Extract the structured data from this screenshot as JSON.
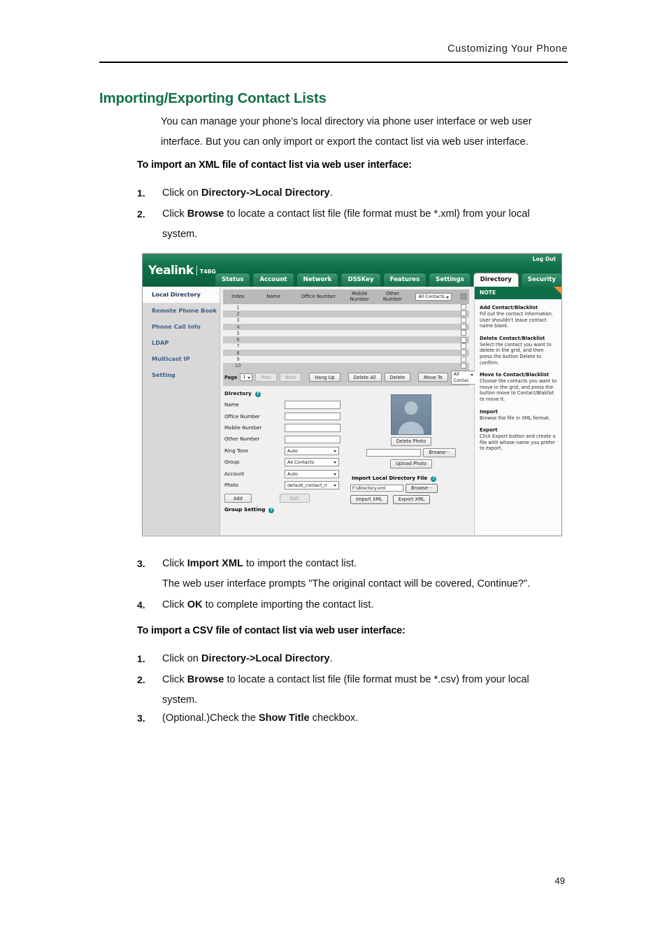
{
  "document": {
    "running_header": "Customizing Your Phone",
    "page_number": "49",
    "section_title": "Importing/Exporting Contact Lists",
    "intro": "You can manage your phone’s local directory via phone user interface or web user interface. But you can only import or export the contact list via web user interface.",
    "xml_section": {
      "heading": "To import an XML file of contact list via web user interface:",
      "steps": [
        {
          "num": "1.",
          "pre": "Click on ",
          "bold": "Directory->Local Directory",
          "post": "."
        },
        {
          "num": "2.",
          "pre": "Click ",
          "bold": "Browse",
          "post": " to locate a contact list file (file format must be *.xml) from your local system."
        },
        {
          "num": "3.",
          "pre": "Click ",
          "bold": "Import XML",
          "post": " to import the contact list."
        },
        {
          "num": "4.",
          "pre": "Click ",
          "bold": "OK",
          "post": " to complete importing the contact list."
        }
      ],
      "prompt_note": "The web user interface prompts \"The original contact will be covered, Continue?\"."
    },
    "csv_section": {
      "heading": "To import a CSV file of contact list via web user interface:",
      "steps": [
        {
          "num": "1.",
          "pre": "Click on ",
          "bold": "Directory->Local Directory",
          "post": "."
        },
        {
          "num": "2.",
          "pre": "Click ",
          "bold": "Browse",
          "post": " to locate a contact list file (file format must be *.csv) from your local system."
        },
        {
          "num": "3.",
          "pre": "(Optional.)Check the ",
          "bold": "Show Title",
          "post": " checkbox."
        }
      ]
    }
  },
  "screenshot": {
    "brand": "Yealink",
    "model": "T48G",
    "logout": "Log Out",
    "tabs": [
      {
        "label": "Status",
        "active": false
      },
      {
        "label": "Account",
        "active": false
      },
      {
        "label": "Network",
        "active": false
      },
      {
        "label": "DSSKey",
        "active": false
      },
      {
        "label": "Features",
        "active": false
      },
      {
        "label": "Settings",
        "active": false
      },
      {
        "label": "Directory",
        "active": true
      },
      {
        "label": "Security",
        "active": false
      }
    ],
    "nav": [
      {
        "label": "Local Directory",
        "active": true
      },
      {
        "label": "Remote Phone Book",
        "active": false
      },
      {
        "label": "Phone Call Info",
        "active": false
      },
      {
        "label": "LDAP",
        "active": false
      },
      {
        "label": "Multicast IP",
        "active": false
      },
      {
        "label": "Setting",
        "active": false
      }
    ],
    "grid": {
      "columns": [
        "Index",
        "Name",
        "Office Number",
        "Mobile Number",
        "Other Number"
      ],
      "filter": "All Contacts",
      "rows": [
        "1",
        "2",
        "3",
        "4",
        "5",
        "6",
        "7",
        "8",
        "9",
        "10"
      ]
    },
    "toolbar": {
      "page_label": "Page",
      "page_value": "1",
      "prev": "Prev",
      "next": "Next",
      "hang_up": "Hang Up",
      "delete_all": "Delete All",
      "delete": "Delete",
      "move_to": "Move To",
      "move_target": "All Contac"
    },
    "form": {
      "title": "Directory",
      "fields": [
        {
          "label": "Name",
          "type": "input",
          "value": ""
        },
        {
          "label": "Office Number",
          "type": "input",
          "value": ""
        },
        {
          "label": "Mobile Number",
          "type": "input",
          "value": ""
        },
        {
          "label": "Other Number",
          "type": "input",
          "value": ""
        },
        {
          "label": "Ring Tone",
          "type": "select",
          "value": "Auto"
        },
        {
          "label": "Group",
          "type": "select",
          "value": "All Contacts"
        },
        {
          "label": "Account",
          "type": "select",
          "value": "Auto"
        },
        {
          "label": "Photo",
          "type": "select",
          "value": "default_contact_ir"
        }
      ],
      "add": "Add",
      "edit": "Edit",
      "group_setting": "Group Setting"
    },
    "photo": {
      "delete_photo": "Delete Photo",
      "browse": "Browse···",
      "upload_photo": "Upload Photo",
      "path_value": ""
    },
    "import": {
      "title": "Import Local Directory File",
      "path_value": "F:\\directory.xml",
      "browse": "Browse···",
      "import_xml": "Import XML",
      "export_xml": "Export XML"
    },
    "note": {
      "title": "NOTE",
      "entries": [
        {
          "head": "Add Contact/Blacklist",
          "text": "Fill out the contact information. User shouldn't leave contact name blank."
        },
        {
          "head": "Delete Contact/Blacklist",
          "text": "Select the contact you want to delete in the grid, and then press the button Delete to confirm."
        },
        {
          "head": "Move to Contact/Blacklist",
          "text": "Choose the contacts you want to move in the grid, and press the button move to Contact/Blaklist to move it."
        },
        {
          "head": "Import",
          "text": "Browse the file in XML format."
        },
        {
          "head": "Export",
          "text": "Click Export button and create a file with whose name you prefer to export."
        }
      ]
    }
  },
  "colors": {
    "brand_green": "#0d6e47",
    "heading_green": "#14704a",
    "tab_green": "#23805c",
    "note_orange": "#f0912b"
  }
}
